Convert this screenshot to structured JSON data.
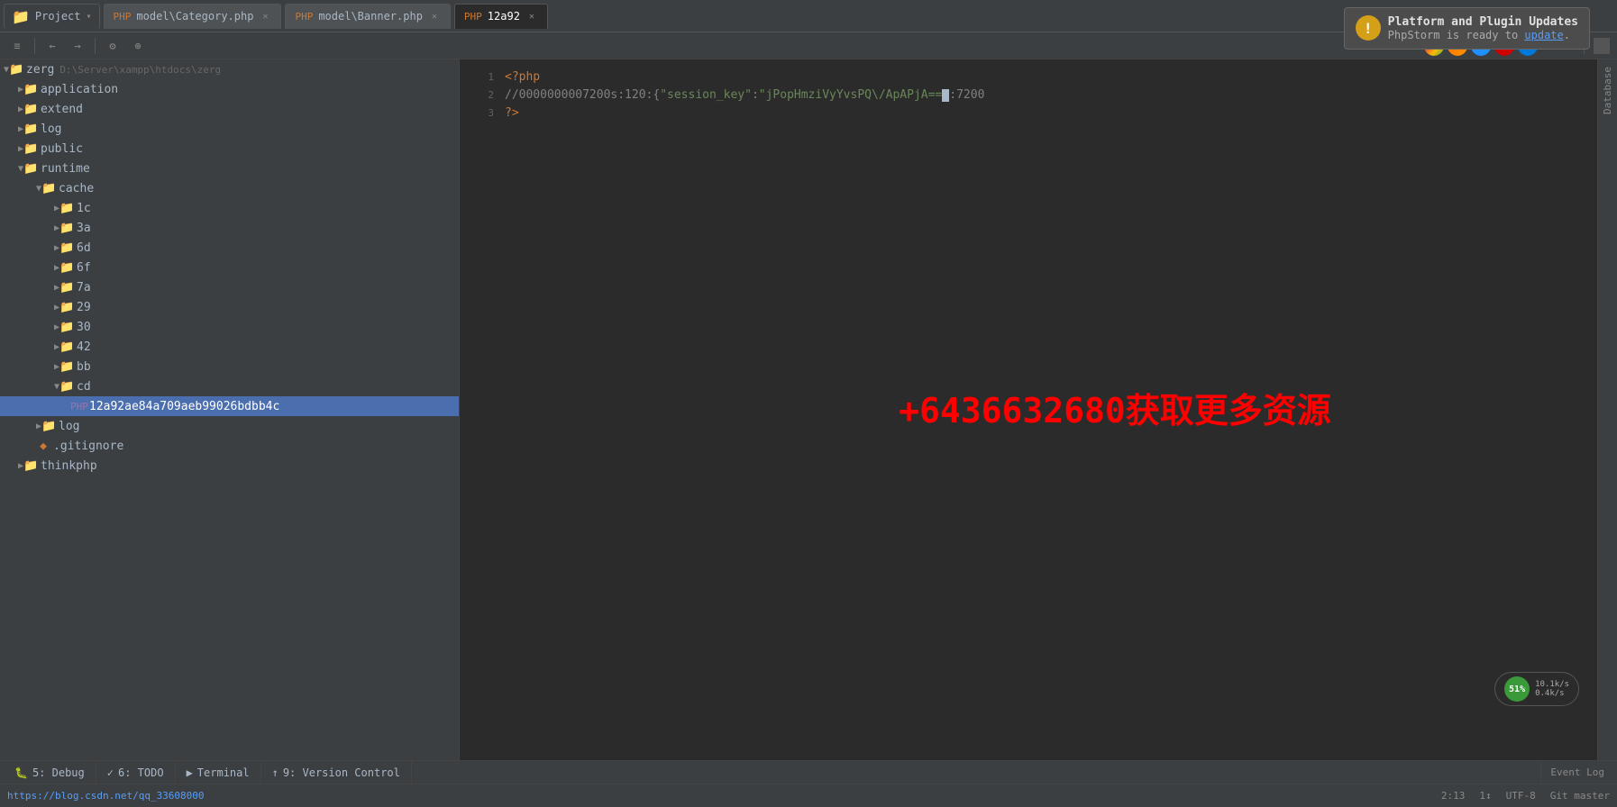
{
  "header": {
    "project_label": "Project",
    "dropdown_arrow": "▾"
  },
  "tabs": [
    {
      "id": "category",
      "label": "model\\Category.php",
      "active": false,
      "icon": "php"
    },
    {
      "id": "banner",
      "label": "model\\Banner.php",
      "active": false,
      "icon": "php"
    },
    {
      "id": "cachefile",
      "label": "12a92...",
      "active": true,
      "icon": "php"
    }
  ],
  "toolbar": {
    "buttons": [
      "≡",
      "←",
      "→",
      "⚙",
      "⊕"
    ]
  },
  "tree": {
    "root": "zerg",
    "root_path": "D:\\Server\\xampp\\htdocs\\zerg",
    "items": [
      {
        "id": "application",
        "label": "application",
        "type": "folder",
        "depth": 1,
        "expanded": false
      },
      {
        "id": "extend",
        "label": "extend",
        "type": "folder",
        "depth": 1,
        "expanded": false
      },
      {
        "id": "log",
        "label": "log",
        "type": "folder",
        "depth": 1,
        "expanded": false
      },
      {
        "id": "public",
        "label": "public",
        "type": "folder",
        "depth": 1,
        "expanded": false
      },
      {
        "id": "runtime",
        "label": "runtime",
        "type": "folder",
        "depth": 1,
        "expanded": true
      },
      {
        "id": "cache",
        "label": "cache",
        "type": "folder",
        "depth": 2,
        "expanded": true
      },
      {
        "id": "1c",
        "label": "1c",
        "type": "folder",
        "depth": 3,
        "expanded": false
      },
      {
        "id": "3a",
        "label": "3a",
        "type": "folder",
        "depth": 3,
        "expanded": false
      },
      {
        "id": "6d",
        "label": "6d",
        "type": "folder",
        "depth": 3,
        "expanded": false
      },
      {
        "id": "6f",
        "label": "6f",
        "type": "folder",
        "depth": 3,
        "expanded": false
      },
      {
        "id": "7a",
        "label": "7a",
        "type": "folder",
        "depth": 3,
        "expanded": false
      },
      {
        "id": "29",
        "label": "29",
        "type": "folder",
        "depth": 3,
        "expanded": false
      },
      {
        "id": "30",
        "label": "30",
        "type": "folder",
        "depth": 3,
        "expanded": false
      },
      {
        "id": "42",
        "label": "42",
        "type": "folder",
        "depth": 3,
        "expanded": false
      },
      {
        "id": "bb",
        "label": "bb",
        "type": "folder",
        "depth": 3,
        "expanded": false
      },
      {
        "id": "cd",
        "label": "cd",
        "type": "folder",
        "depth": 3,
        "expanded": true
      },
      {
        "id": "cachefile",
        "label": "12a92ae84a709aeb99026bdbb4c",
        "type": "file",
        "depth": 4,
        "selected": true
      },
      {
        "id": "log2",
        "label": "log",
        "type": "folder",
        "depth": 2,
        "expanded": false
      },
      {
        "id": "gitignore",
        "label": ".gitignore",
        "type": "file-git",
        "depth": 2,
        "expanded": false
      },
      {
        "id": "thinkphp",
        "label": "thinkphp",
        "type": "folder",
        "depth": 1,
        "expanded": false
      }
    ]
  },
  "editor": {
    "filename": "12a92ae84a709aeb99026bdbb4c",
    "lines": [
      {
        "num": "1",
        "content": "<?php",
        "type": "keyword"
      },
      {
        "num": "2",
        "content": "//0000000007200s:120:{\"session_key\":\"jPopHmziVyYvsPQ\\/ApAPjA==:7200",
        "type": "comment"
      },
      {
        "num": "3",
        "content": "?>",
        "type": "keyword"
      }
    ]
  },
  "watermark": "+6436632680获取更多资源",
  "notification": {
    "title": "Platform and Plugin Updates",
    "body": "PhpStorm is ready to ",
    "link": "update",
    "link_suffix": "."
  },
  "right_sidebar": {
    "tabs": [
      "Database"
    ]
  },
  "bottom_tabs": [
    {
      "id": "debug",
      "label": "5: Debug",
      "icon": "🐛"
    },
    {
      "id": "todo",
      "label": "6: TODO",
      "icon": "✓"
    },
    {
      "id": "terminal",
      "label": "Terminal",
      "icon": "▶"
    },
    {
      "id": "version-control",
      "label": "9: Version Control",
      "icon": "↑"
    }
  ],
  "bottom_right_tabs": [
    {
      "id": "event-log",
      "label": "Event Log"
    }
  ],
  "status_bar": {
    "position": "2:13",
    "column": "1↕",
    "encoding": "UTF-8",
    "line_separator": "Git master",
    "url": "https://blog.csdn.net/qq_33608000"
  },
  "network": {
    "percent": "51%",
    "upload": "10.1k/s",
    "download": "0.4k/s"
  }
}
